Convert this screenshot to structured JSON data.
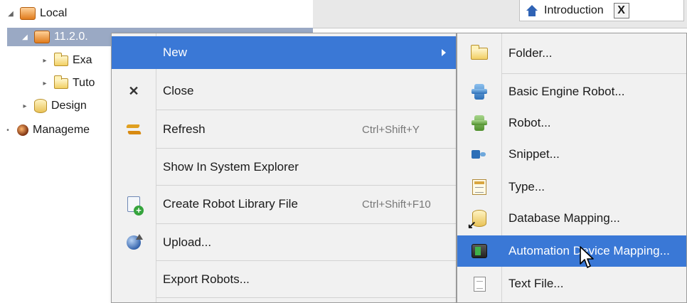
{
  "tree": {
    "items": [
      {
        "label": "Local",
        "icon": "package-icon"
      },
      {
        "label": "11.2.0.",
        "icon": "package-icon"
      },
      {
        "label": "Exa",
        "icon": "folder-icon"
      },
      {
        "label": "Tuto",
        "icon": "folder-icon"
      },
      {
        "label": "Design",
        "icon": "database-icon"
      },
      {
        "label": "Manageme",
        "icon": "management-icon"
      }
    ]
  },
  "tabs": {
    "introduction_label": "Introduction",
    "close_glyph": "X"
  },
  "context_menu": {
    "items": [
      {
        "label": "New",
        "icon": "none"
      },
      {
        "label": "Close",
        "icon": "close-icon"
      },
      {
        "label": "Refresh",
        "shortcut": "Ctrl+Shift+Y",
        "icon": "refresh-icon"
      },
      {
        "label": "Show In System Explorer",
        "icon": "none"
      },
      {
        "label": "Create Robot Library File",
        "shortcut": "Ctrl+Shift+F10",
        "icon": "robot-library-icon"
      },
      {
        "label": "Upload...",
        "icon": "upload-icon"
      },
      {
        "label": "Export Robots...",
        "icon": "none"
      }
    ]
  },
  "submenu": {
    "items": [
      {
        "label": "Folder...",
        "icon": "folder-icon"
      },
      {
        "label": "Basic Engine Robot...",
        "icon": "basic-engine-robot-icon"
      },
      {
        "label": "Robot...",
        "icon": "robot-icon"
      },
      {
        "label": "Snippet...",
        "icon": "snippet-icon"
      },
      {
        "label": "Type...",
        "icon": "type-icon"
      },
      {
        "label": "Database Mapping...",
        "icon": "database-mapping-icon"
      },
      {
        "label": "Automation Device Mapping...",
        "icon": "automation-device-icon"
      },
      {
        "label": "Text File...",
        "icon": "text-file-icon"
      }
    ]
  },
  "colors": {
    "highlight": "#3a78d6",
    "tree_selection": "#9aa9c4",
    "menu_bg": "#f1f1f1"
  }
}
